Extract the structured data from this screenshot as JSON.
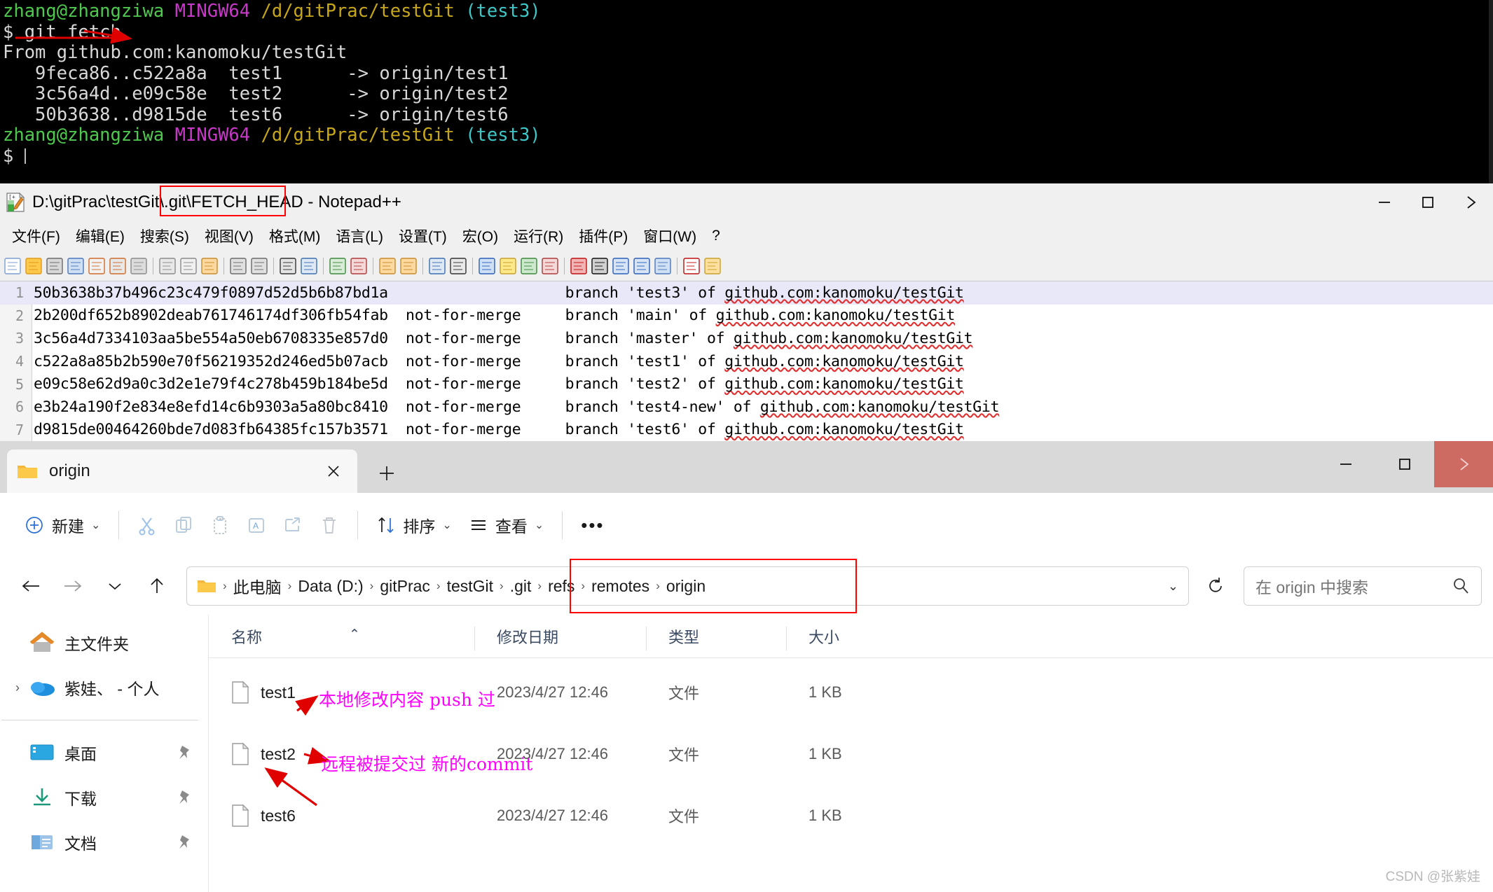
{
  "terminal": {
    "lines": [
      {
        "segments": [
          {
            "text": "zhang@zhangziwa",
            "color": "green"
          },
          {
            "text": " ",
            "color": "white"
          },
          {
            "text": "MINGW64",
            "color": "magenta"
          },
          {
            "text": " ",
            "color": "white"
          },
          {
            "text": "/d/gitPrac/testGit",
            "color": "yellow"
          },
          {
            "text": " ",
            "color": "white"
          },
          {
            "text": "(test3)",
            "color": "cyan"
          }
        ]
      },
      {
        "segments": [
          {
            "text": "$ git fetch",
            "color": "white"
          }
        ]
      },
      {
        "segments": [
          {
            "text": "From github.com:kanomoku/testGit",
            "color": "white"
          }
        ]
      },
      {
        "segments": [
          {
            "text": "   9feca86..c522a8a  test1      -> origin/test1",
            "color": "white"
          }
        ]
      },
      {
        "segments": [
          {
            "text": "   3c56a4d..e09c58e  test2      -> origin/test2",
            "color": "white"
          }
        ]
      },
      {
        "segments": [
          {
            "text": "   50b3638..d9815de  test6      -> origin/test6",
            "color": "white"
          }
        ]
      },
      {
        "segments": [
          {
            "text": "",
            "color": "white"
          }
        ]
      },
      {
        "segments": [
          {
            "text": "zhang@zhangziwa",
            "color": "green"
          },
          {
            "text": " ",
            "color": "white"
          },
          {
            "text": "MINGW64",
            "color": "magenta"
          },
          {
            "text": " ",
            "color": "white"
          },
          {
            "text": "/d/gitPrac/testGit",
            "color": "yellow"
          },
          {
            "text": " ",
            "color": "white"
          },
          {
            "text": "(test3)",
            "color": "cyan"
          }
        ]
      },
      {
        "segments": [
          {
            "text": "$",
            "color": "white"
          }
        ]
      }
    ],
    "annotation_target": "git fetch"
  },
  "notepad": {
    "title": "D:\\gitPrac\\testGit\\.git\\FETCH_HEAD - Notepad++",
    "title_highlight": "\\.git\\FETCH_HEAD",
    "app_icon": "notepadpp-icon",
    "window_controls": [
      {
        "name": "minimize-button",
        "glyph": "—"
      },
      {
        "name": "maximize-button",
        "glyph": "□"
      },
      {
        "name": "close-button",
        "glyph": "✕"
      }
    ],
    "menu": [
      "文件(F)",
      "编辑(E)",
      "搜索(S)",
      "视图(V)",
      "格式(M)",
      "语言(L)",
      "设置(T)",
      "宏(O)",
      "运行(R)",
      "插件(P)",
      "窗口(W)",
      "?"
    ],
    "toolbar_icons": [
      "new-file-icon",
      "open-file-icon",
      "save-icon",
      "save-all-icon",
      "close-file-icon",
      "close-all-icon",
      "print-icon",
      "sep",
      "cut-icon",
      "copy-icon",
      "paste-icon",
      "sep",
      "undo-icon",
      "redo-icon",
      "sep",
      "find-icon",
      "replace-icon",
      "sep",
      "zoom-in-icon",
      "zoom-out-icon",
      "sep",
      "sync-scroll-v-icon",
      "sync-scroll-h-icon",
      "sep",
      "word-wrap-icon",
      "show-all-chars-icon",
      "sep",
      "indent-guide-icon",
      "user-lang-icon",
      "doc-map-icon",
      "function-list-icon",
      "sep",
      "record-macro-icon",
      "stop-macro-icon",
      "play-macro-icon",
      "fast-play-macro-icon",
      "save-macro-icon",
      "sep",
      "spellcheck-icon",
      "doc-list-icon"
    ],
    "editor": {
      "selected_line": 1,
      "lines": [
        {
          "n": "1",
          "hash": "50b3638b37b496c23c479f0897d52d5b6b87bd1a",
          "merge": "",
          "desc_prefix": "branch 'test3' of ",
          "repo": "github.com:kanomoku/testGit"
        },
        {
          "n": "2",
          "hash": "2b200df652b8902deab761746174df306fb54fab",
          "merge": "not-for-merge",
          "desc_prefix": "branch 'main' of ",
          "repo": "github.com:kanomoku/testGit"
        },
        {
          "n": "3",
          "hash": "3c56a4d7334103aa5be554a50eb6708335e857d0",
          "merge": "not-for-merge",
          "desc_prefix": "branch 'master' of ",
          "repo": "github.com:kanomoku/testGit"
        },
        {
          "n": "4",
          "hash": "c522a8a85b2b590e70f56219352d246ed5b07acb",
          "merge": "not-for-merge",
          "desc_prefix": "branch 'test1' of ",
          "repo": "github.com:kanomoku/testGit"
        },
        {
          "n": "5",
          "hash": "e09c58e62d9a0c3d2e1e79f4c278b459b184be5d",
          "merge": "not-for-merge",
          "desc_prefix": "branch 'test2' of ",
          "repo": "github.com:kanomoku/testGit"
        },
        {
          "n": "6",
          "hash": "e3b24a190f2e834e8efd14c6b9303a5a80bc8410",
          "merge": "not-for-merge",
          "desc_prefix": "branch 'test4-new' of ",
          "repo": "github.com:kanomoku/testGit"
        },
        {
          "n": "7",
          "hash": "d9815de00464260bde7d083fb64385fc157b3571",
          "merge": "not-for-merge",
          "desc_prefix": "branch 'test6' of ",
          "repo": "github.com:kanomoku/testGit"
        }
      ]
    }
  },
  "explorer": {
    "tab": {
      "label": "origin",
      "icon": "folder-icon",
      "close": "✕"
    },
    "new_tab": "+",
    "window_controls": [
      {
        "name": "minimize-button",
        "glyph": "—"
      },
      {
        "name": "maximize-button",
        "glyph": "□"
      },
      {
        "name": "close-button",
        "glyph": "✕"
      }
    ],
    "commandbar": {
      "new_label": "新建",
      "new_chevron": "⌄",
      "icons": [
        "cut-icon",
        "copy-icon",
        "paste-icon",
        "rename-icon",
        "share-icon",
        "delete-icon"
      ],
      "sort_label": "排序",
      "sort_chevron": "⌄",
      "view_label": "查看",
      "view_chevron": "⌄",
      "more_label": "•••"
    },
    "nav": {
      "back": "←",
      "forward": "→",
      "recent_chevron": "⌄",
      "up": "↑",
      "refresh": "⟳",
      "address_chevron": "⌄"
    },
    "breadcrumb": {
      "icon": "folder-icon",
      "items": [
        "此电脑",
        "Data (D:)",
        "gitPrac",
        "testGit",
        ".git",
        "refs",
        "remotes",
        "origin"
      ],
      "separator": "›",
      "highlight_from": ".git"
    },
    "search": {
      "placeholder": "在 origin 中搜索",
      "icon": "search-icon"
    },
    "sidebar": [
      {
        "label": "主文件夹",
        "icon": "home-icon",
        "expandable": false,
        "pinned": false
      },
      {
        "label": "紫娃、 - 个人",
        "icon": "onedrive-icon",
        "expandable": true,
        "chevron": "›",
        "pinned": false
      },
      {
        "label": "桌面",
        "icon": "desktop-icon",
        "expandable": false,
        "pinned": true
      },
      {
        "label": "下载",
        "icon": "downloads-icon",
        "expandable": false,
        "pinned": true
      },
      {
        "label": "文档",
        "icon": "documents-icon",
        "expandable": false,
        "pinned": true
      }
    ],
    "columns": [
      {
        "label": "名称",
        "sorted": true,
        "sort_caret": "⌃"
      },
      {
        "label": "修改日期",
        "sorted": false
      },
      {
        "label": "类型",
        "sorted": false
      },
      {
        "label": "大小",
        "sorted": false
      }
    ],
    "files": [
      {
        "name": "test1",
        "icon": "file-icon",
        "modified": "2023/4/27 12:46",
        "type": "文件",
        "size": "1 KB"
      },
      {
        "name": "test2",
        "icon": "file-icon",
        "modified": "2023/4/27 12:46",
        "type": "文件",
        "size": "1 KB"
      },
      {
        "name": "test6",
        "icon": "file-icon",
        "modified": "2023/4/27 12:46",
        "type": "文件",
        "size": "1 KB"
      }
    ],
    "annotations": [
      {
        "text": "本地修改内容 push 过",
        "target": "test1"
      },
      {
        "text": "远程被提交过 新的commit",
        "target": "test2"
      }
    ]
  },
  "watermark": "CSDN @张紫娃",
  "colors": {
    "annotation": "#ff00ff",
    "redbox": "#ff0000",
    "arrow": "#e00000",
    "close_hover": "#cd6a62"
  }
}
